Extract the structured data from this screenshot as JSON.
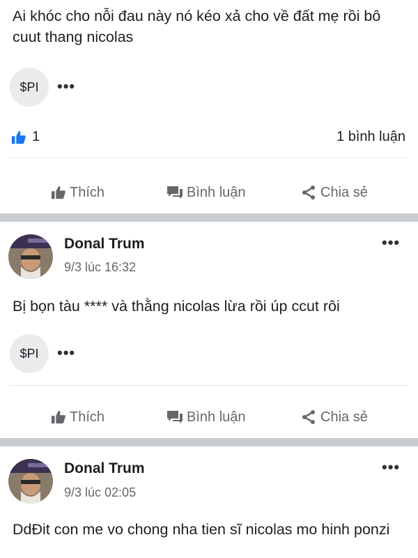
{
  "post1": {
    "text": "Ai khóc cho nỗi đau này nó kéo xả cho về đất mẹ rồi bô cuut thang nicolas",
    "tag": "$PI",
    "more": "•••",
    "like_count": "1",
    "comment_count": "1 bình luận"
  },
  "actions": {
    "like": "Thích",
    "comment": "Bình luận",
    "share": "Chia sẻ"
  },
  "comments": [
    {
      "author": "Donal Trum",
      "time": "9/3 lúc 16:32",
      "text": "Bị bọn tàu **** và thằng nicolas lừa rồi úp ccut rôi",
      "tag": "$PI",
      "more": "•••",
      "menu": "•••"
    },
    {
      "author": "Donal Trum",
      "time": "9/3 lúc 02:05",
      "text": "DdĐit con me vo chong nha tien sĩ nicolas mo hinh ponzi",
      "menu": "•••"
    }
  ],
  "colors": {
    "accent": "#1877f2",
    "muted": "#65676b",
    "separator": "#c9ccd1"
  }
}
